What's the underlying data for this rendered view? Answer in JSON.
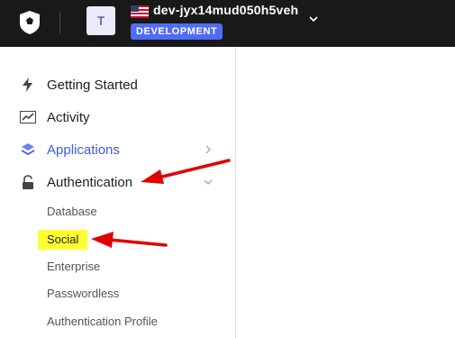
{
  "header": {
    "tenant_initial": "T",
    "tenant_name": "dev-jyx14mud050h5veh",
    "environment_badge": "DEVELOPMENT",
    "icons": [
      "auth0-logo-icon",
      "us-flag-icon",
      "chevron-down-icon"
    ]
  },
  "sidebar": {
    "items": [
      {
        "label": "Getting Started",
        "icon": "lightning-icon"
      },
      {
        "label": "Activity",
        "icon": "chart-trend-icon"
      },
      {
        "label": "Applications",
        "icon": "layers-icon",
        "active": true,
        "chevron": "chevron-right-icon"
      },
      {
        "label": "Authentication",
        "icon": "unlock-icon",
        "chevron": "chevron-down-icon"
      }
    ],
    "authentication_subitems": [
      {
        "label": "Database"
      },
      {
        "label": "Social",
        "highlighted": true
      },
      {
        "label": "Enterprise"
      },
      {
        "label": "Passwordless"
      },
      {
        "label": "Authentication Profile"
      }
    ]
  },
  "annotations": {
    "arrow_color": "#e00000",
    "highlight_color": "#ffff33"
  },
  "colors": {
    "topbar_bg": "#191919",
    "accent": "#3f59e4",
    "badge_bg": "#4f6cf7"
  }
}
